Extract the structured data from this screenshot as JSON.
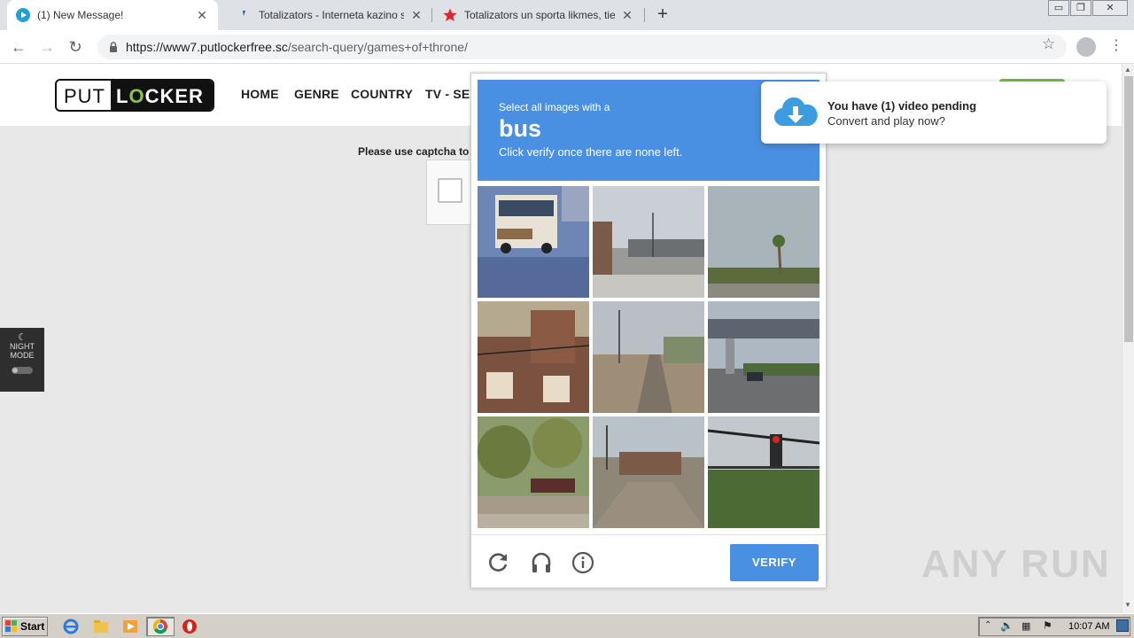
{
  "tabs": [
    {
      "title": "(1) New Message!",
      "active": true
    },
    {
      "title": "Totalizators - Interneta kazino spēles",
      "active": false
    },
    {
      "title": "Totalizators un sporta likmes, tiešraides",
      "active": false
    }
  ],
  "address": {
    "host": "https://www7.putlockerfree.sc",
    "path": "/search-query/games+of+throne/"
  },
  "site": {
    "logo_put": "PUT",
    "logo_locker_a": "L",
    "logo_locker_o": "O",
    "logo_locker_b": "CKER",
    "nav": [
      "HOME",
      "GENRE",
      "COUNTRY",
      "TV - SERIES"
    ],
    "captcha_message": "Please use captcha to continue"
  },
  "night_mode": {
    "line1": "NIGHT",
    "line2": "MODE"
  },
  "challenge": {
    "line1": "Select all images with a",
    "target": "bus",
    "line3": "Click verify once there are none left.",
    "verify_label": "VERIFY"
  },
  "notification": {
    "title": "You have (1) video pending",
    "subtitle": "Convert and play now?"
  },
  "watermark": "ANY RUN",
  "taskbar": {
    "start_label": "Start",
    "clock": "10:07 AM"
  },
  "colors": {
    "accent": "#4a90e2",
    "logo_green": "#8bc34a",
    "search_green": "#6cc04a"
  }
}
